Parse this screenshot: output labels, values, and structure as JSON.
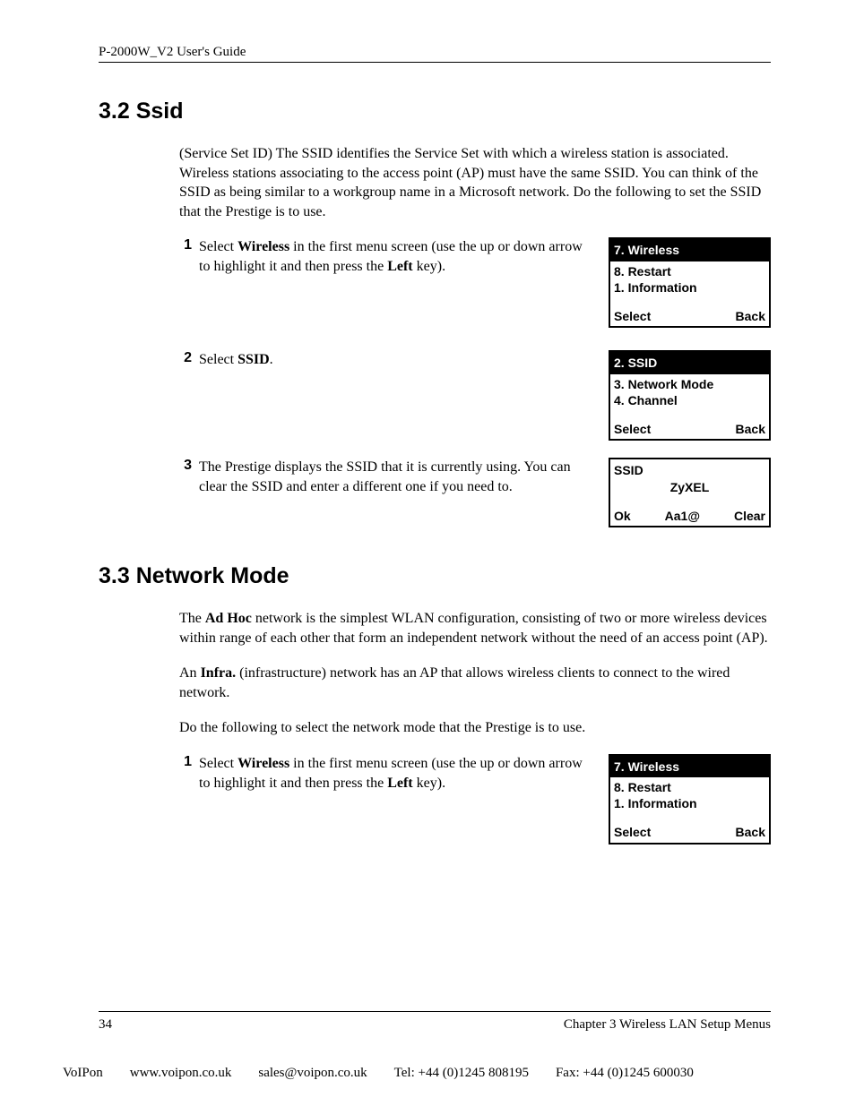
{
  "header": {
    "title": "P-2000W_V2 User's Guide"
  },
  "section32": {
    "heading": "3.2  Ssid",
    "intro": "(Service Set ID) The SSID identifies the Service Set with which a wireless station is associated. Wireless stations associating to the access point (AP) must have the same SSID. You can think of the SSID as being similar to a workgroup name in a Microsoft network. Do the following to set the SSID that the Prestige is to use.",
    "steps": {
      "s1": {
        "num": "1",
        "pre": "Select ",
        "bold1": "Wireless",
        "mid": " in the first menu screen (use the up or down arrow to highlight it and then press the ",
        "bold2": "Left",
        "post": " key)."
      },
      "s2": {
        "num": "2",
        "pre": "Select ",
        "bold1": "SSID",
        "post": "."
      },
      "s3": {
        "num": "3",
        "text": "The Prestige displays the SSID that it is currently using. You can clear the SSID and enter a different one if you need to."
      }
    },
    "lcd1": {
      "top": "7. Wireless",
      "l1": "8. Restart",
      "l2": "1. Information",
      "bl": "Select",
      "br": "Back"
    },
    "lcd2": {
      "top": "2. SSID",
      "l1": "3. Network Mode",
      "l2": "4. Channel",
      "bl": "Select",
      "br": "Back"
    },
    "lcd3": {
      "top": "SSID",
      "center": "ZyXEL",
      "bl": "Ok",
      "bm": "Aa1@",
      "br": "Clear"
    }
  },
  "section33": {
    "heading": "3.3  Network Mode",
    "p1": {
      "pre": "The ",
      "bold": "Ad Hoc",
      "post": " network is the simplest WLAN configuration, consisting of two or more wireless devices within range of each other that form an independent network without the need of an access point (AP)."
    },
    "p2": {
      "pre": "An ",
      "bold": "Infra.",
      "post": " (infrastructure) network has an AP that allows wireless clients to connect to the wired network."
    },
    "p3": "Do the following to select the network mode that the Prestige is to use.",
    "steps": {
      "s1": {
        "num": "1",
        "pre": "Select ",
        "bold1": "Wireless",
        "mid": " in the first menu screen (use the up or down arrow to highlight it and then press the ",
        "bold2": "Left",
        "post": " key)."
      }
    },
    "lcd1": {
      "top": "7. Wireless",
      "l1": "8. Restart",
      "l2": "1. Information",
      "bl": "Select",
      "br": "Back"
    }
  },
  "footer": {
    "page": "34",
    "chapter": "Chapter 3 Wireless LAN Setup Menus",
    "company": "VoIPon",
    "url": "www.voipon.co.uk",
    "email": "sales@voipon.co.uk",
    "tel": "Tel: +44 (0)1245 808195",
    "fax": "Fax: +44 (0)1245 600030"
  }
}
